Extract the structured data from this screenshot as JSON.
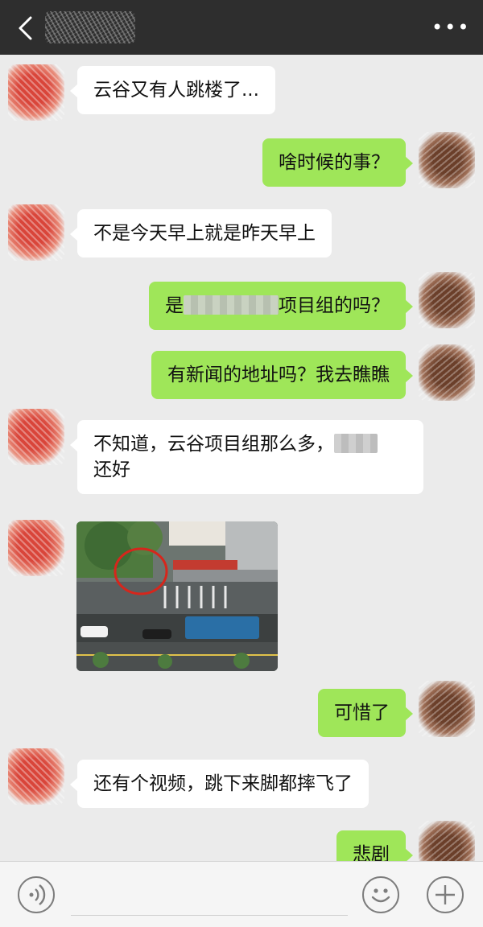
{
  "header": {
    "back_icon": "chevron-left-icon",
    "more_label": "•••"
  },
  "messages": [
    {
      "side": "left",
      "text": "云谷又有人跳楼了..."
    },
    {
      "side": "right",
      "text": "啥时候的事？"
    },
    {
      "side": "left",
      "text": "不是今天早上就是昨天早上"
    },
    {
      "side": "right",
      "text_before": "是",
      "text_after": "项目组的吗？"
    },
    {
      "side": "right",
      "text": "有新闻的地址吗？我去瞧瞧"
    },
    {
      "side": "left",
      "line1": "不知道，云谷项目组那么多，",
      "line2": "还好"
    },
    {
      "side": "left",
      "type": "image"
    },
    {
      "side": "right",
      "text": "可惜了"
    },
    {
      "side": "left",
      "text": "还有个视频，跳下来脚都摔飞了"
    },
    {
      "side": "right",
      "text": "悲剧"
    }
  ],
  "input_bar": {
    "voice_icon": "voice-icon",
    "emoji_icon": "emoji-icon",
    "plus_icon": "plus-icon"
  },
  "colors": {
    "header_bg": "#2e2e2e",
    "chat_bg": "#ebebeb",
    "outgoing_bubble": "#9fe659",
    "incoming_bubble": "#ffffff"
  }
}
